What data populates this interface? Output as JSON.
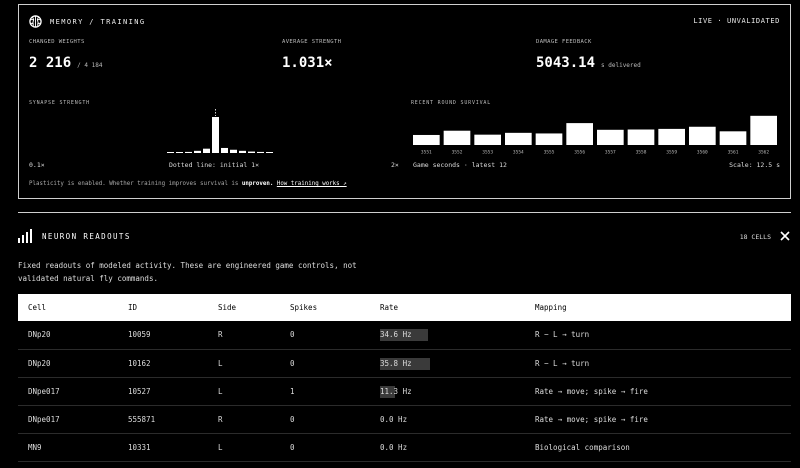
{
  "memory": {
    "title": "MEMORY / TRAINING",
    "status": "LIVE · UNVALIDATED",
    "changed_weights": {
      "label": "CHANGED WEIGHTS",
      "value": "2 216",
      "suffix": "/ 4 184"
    },
    "average_strength": {
      "label": "AVERAGE STRENGTH",
      "value": "1.031×"
    },
    "damage_feedback": {
      "label": "DAMAGE FEEDBACK",
      "value": "5043.14",
      "suffix": "s delivered"
    },
    "synapse": {
      "label": "SYNAPSE STRENGTH",
      "min_label": "0.1×",
      "mid_label": "Dotted line: initial 1×",
      "max_label": "2×"
    },
    "survival": {
      "label": "RECENT ROUND SURVIVAL",
      "caption": "Game seconds · latest 12",
      "scale_label": "Scale: 12.5 s"
    },
    "note": {
      "prefix": "Plasticity is enabled. Whether training improves survival is",
      "emphasis": "unproven.",
      "link": "How training works ↗"
    }
  },
  "chart_data": [
    {
      "type": "bar",
      "title": "SYNAPSE STRENGTH",
      "values": [
        0.02,
        0.02,
        0.03,
        0.06,
        0.12,
        1.0,
        0.14,
        0.09,
        0.06,
        0.04,
        0.03,
        0.02
      ],
      "ylim": [
        0,
        1
      ]
    },
    {
      "type": "bar",
      "title": "RECENT ROUND SURVIVAL",
      "categories": [
        "3551",
        "3552",
        "3553",
        "3554",
        "3555",
        "3556",
        "3557",
        "3558",
        "3559",
        "3560",
        "3561",
        "3562"
      ],
      "values": [
        3.3,
        4.7,
        3.4,
        4.0,
        3.8,
        7.2,
        5.0,
        5.1,
        5.3,
        6.0,
        4.5,
        9.6
      ],
      "ylim": [
        0,
        12.5
      ]
    }
  ],
  "neurons": {
    "title": "NEURON READOUTS",
    "count": "18 CELLS",
    "description": "Fixed readouts of modeled activity. These are engineered game controls, not validated natural fly commands.",
    "columns": [
      "Cell",
      "ID",
      "Side",
      "Spikes",
      "Rate",
      "Mapping"
    ],
    "rows": [
      {
        "cell": "DNp20",
        "id": "10059",
        "side": "R",
        "spikes": "0",
        "rate": "34.6 Hz",
        "rate_level": 0.87,
        "mapping": "R − L → turn"
      },
      {
        "cell": "DNp20",
        "id": "10162",
        "side": "L",
        "spikes": "0",
        "rate": "35.8 Hz",
        "rate_level": 0.9,
        "mapping": "R − L → turn"
      },
      {
        "cell": "DNpe017",
        "id": "10527",
        "side": "L",
        "spikes": "1",
        "rate": "11.3 Hz",
        "rate_level": 0.28,
        "mapping": "Rate → move; spike → fire"
      },
      {
        "cell": "DNpe017",
        "id": "555871",
        "side": "R",
        "spikes": "0",
        "rate": "0.0 Hz",
        "rate_level": 0,
        "mapping": "Rate → move; spike → fire"
      },
      {
        "cell": "MN9",
        "id": "10331",
        "side": "L",
        "spikes": "0",
        "rate": "0.0 Hz",
        "rate_level": 0,
        "mapping": "Biological comparison"
      }
    ]
  }
}
